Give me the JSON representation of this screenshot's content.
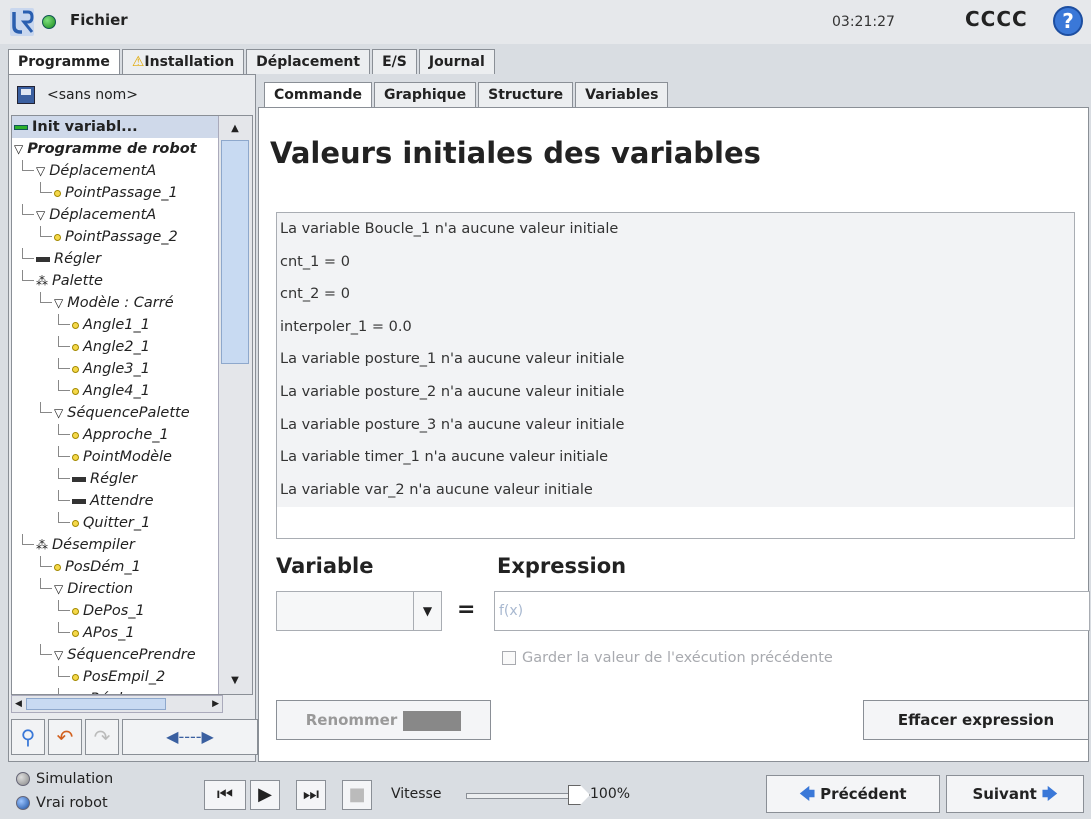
{
  "topbar": {
    "menu_label": "Fichier",
    "clock": "03:21:27",
    "robot_name": "CCCC",
    "help_label": "?"
  },
  "main_tabs": [
    {
      "label": "Programme",
      "active": true
    },
    {
      "label": "Installation",
      "warning": true
    },
    {
      "label": "Déplacement"
    },
    {
      "label": "E/S"
    },
    {
      "label": "Journal"
    }
  ],
  "program": {
    "name": "<sans nom>",
    "tree": [
      {
        "label": "Init variabl...",
        "indent": 0,
        "icon": "bar-green",
        "selected": true
      },
      {
        "label": "Programme de robot",
        "indent": 0,
        "icon": "triangle",
        "bold": true
      },
      {
        "label": "DéplacementA",
        "indent": 1,
        "icon": "triangle"
      },
      {
        "label": "PointPassage_1",
        "indent": 2,
        "icon": "dot"
      },
      {
        "label": "DéplacementA",
        "indent": 1,
        "icon": "triangle"
      },
      {
        "label": "PointPassage_2",
        "indent": 2,
        "icon": "dot"
      },
      {
        "label": "Régler",
        "indent": 1,
        "icon": "bar"
      },
      {
        "label": "Palette",
        "indent": 1,
        "icon": "pallet"
      },
      {
        "label": "Modèle : Carré",
        "indent": 2,
        "icon": "triangle"
      },
      {
        "label": "Angle1_1",
        "indent": 3,
        "icon": "dot"
      },
      {
        "label": "Angle2_1",
        "indent": 3,
        "icon": "dot"
      },
      {
        "label": "Angle3_1",
        "indent": 3,
        "icon": "dot"
      },
      {
        "label": "Angle4_1",
        "indent": 3,
        "icon": "dot"
      },
      {
        "label": "SéquencePalette",
        "indent": 2,
        "icon": "triangle"
      },
      {
        "label": "Approche_1",
        "indent": 3,
        "icon": "dot"
      },
      {
        "label": "PointModèle",
        "indent": 3,
        "icon": "dot"
      },
      {
        "label": "Régler",
        "indent": 3,
        "icon": "bar"
      },
      {
        "label": "Attendre",
        "indent": 3,
        "icon": "bar"
      },
      {
        "label": "Quitter_1",
        "indent": 3,
        "icon": "dot"
      },
      {
        "label": "Désempiler",
        "indent": 1,
        "icon": "pallet"
      },
      {
        "label": "PosDém_1",
        "indent": 2,
        "icon": "dot"
      },
      {
        "label": "Direction",
        "indent": 2,
        "icon": "triangle"
      },
      {
        "label": "DePos_1",
        "indent": 3,
        "icon": "dot"
      },
      {
        "label": "APos_1",
        "indent": 3,
        "icon": "dot"
      },
      {
        "label": "SéquencePrendre",
        "indent": 2,
        "icon": "triangle"
      },
      {
        "label": "PosEmpil_2",
        "indent": 3,
        "icon": "dot"
      },
      {
        "label": "Régler",
        "indent": 3,
        "icon": "bar"
      }
    ]
  },
  "sub_tabs": [
    {
      "label": "Commande",
      "active": true
    },
    {
      "label": "Graphique"
    },
    {
      "label": "Structure"
    },
    {
      "label": "Variables"
    }
  ],
  "content": {
    "title": "Valeurs initiales des variables",
    "variables": [
      "La variable Boucle_1 n'a aucune valeur initiale",
      "cnt_1 = 0",
      "cnt_2 = 0",
      "interpoler_1 = 0.0",
      "La variable posture_1 n'a aucune valeur initiale",
      "La variable posture_2 n'a aucune valeur initiale",
      "La variable posture_3 n'a aucune valeur initiale",
      "La variable timer_1 n'a aucune valeur initiale",
      "La variable var_2 n'a aucune valeur initiale"
    ],
    "variable_label": "Variable",
    "expression_label": "Expression",
    "equals": "=",
    "expression_placeholder": "f(x)",
    "keep_value_label": "Garder la valeur de l'exécution précédente",
    "rename_label": "Renommer",
    "clear_label": "Effacer expression"
  },
  "footer": {
    "simulation_label": "Simulation",
    "real_robot_label": "Vrai robot",
    "speed_label": "Vitesse",
    "speed_value": "100%",
    "speed_fraction": 1.0,
    "prev_label": "Précédent",
    "next_label": "Suivant"
  }
}
